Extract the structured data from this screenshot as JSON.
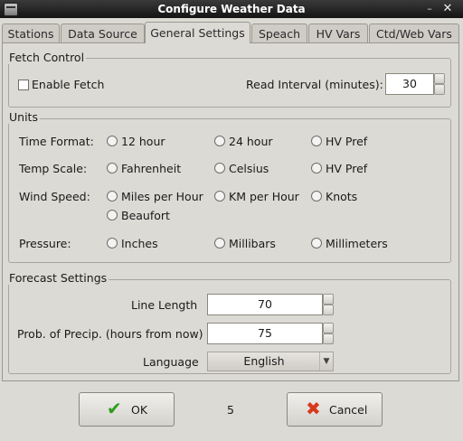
{
  "window": {
    "title": "Configure Weather Data",
    "minimize": "–",
    "close": "✕"
  },
  "tabs": [
    {
      "label": "Stations"
    },
    {
      "label": "Data Source"
    },
    {
      "label": "General Settings"
    },
    {
      "label": "Speach"
    },
    {
      "label": "HV Vars"
    },
    {
      "label": "Ctd/Web Vars"
    }
  ],
  "active_tab": "General Settings",
  "fetch_control": {
    "legend": "Fetch Control",
    "enable_fetch": {
      "label": "Enable Fetch",
      "checked": false
    },
    "read_interval": {
      "label": "Read Interval (minutes):",
      "value": "30"
    }
  },
  "units": {
    "legend": "Units",
    "time_format": {
      "label": "Time Format:",
      "options": [
        "12 hour",
        "24 hour",
        "HV Pref"
      ]
    },
    "temp_scale": {
      "label": "Temp Scale:",
      "options": [
        "Fahrenheit",
        "Celsius",
        "HV Pref"
      ]
    },
    "wind_speed": {
      "label": "Wind Speed:",
      "options": [
        "Miles per Hour",
        "KM per Hour",
        "Knots",
        "Beaufort"
      ]
    },
    "pressure": {
      "label": "Pressure:",
      "options": [
        "Inches",
        "Millibars",
        "Millimeters"
      ]
    }
  },
  "forecast": {
    "legend": "Forecast Settings",
    "line_length": {
      "label": "Line Length",
      "value": "70"
    },
    "prob_precip": {
      "label": "Prob. of Precip. (hours from now)",
      "value": "75"
    },
    "language": {
      "label": "Language",
      "value": "English"
    }
  },
  "buttons": {
    "ok": "OK",
    "cancel": "Cancel",
    "middle_text": "5"
  },
  "colors": {
    "ok_icon": "#2a9d1a",
    "cancel_icon": "#d8391c"
  }
}
